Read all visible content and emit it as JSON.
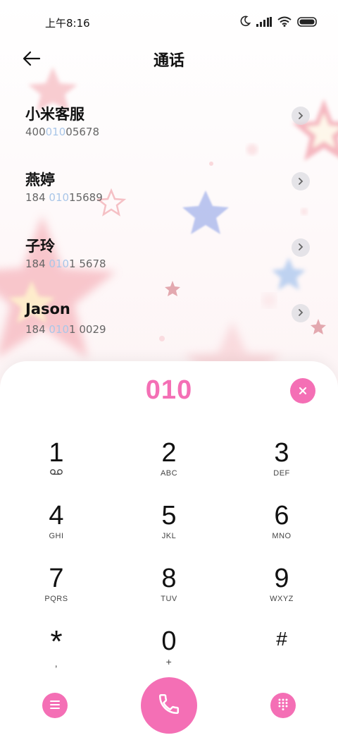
{
  "status_bar": {
    "time": "上午8:16",
    "icons": [
      "moon-icon",
      "signal-icon",
      "wifi-icon",
      "battery-icon"
    ]
  },
  "header": {
    "title": "通话",
    "back_icon": "arrow-left-icon"
  },
  "contacts": [
    {
      "name": "小米客服",
      "number_pre": "400",
      "number_hl": "010",
      "number_post": "05678"
    },
    {
      "name": "燕婷",
      "number_pre": "184 ",
      "number_hl": "010",
      "number_post": "15689"
    },
    {
      "name": "子玲",
      "number_pre": "184 ",
      "number_hl": "010",
      "number_post": "1 5678"
    },
    {
      "name": "Jason",
      "number_pre": "184 ",
      "number_hl": "010",
      "number_post": "1 0029"
    }
  ],
  "dialer": {
    "number": "010",
    "keys": [
      {
        "digit": "1",
        "letters": ""
      },
      {
        "digit": "2",
        "letters": "ABC"
      },
      {
        "digit": "3",
        "letters": "DEF"
      },
      {
        "digit": "4",
        "letters": "GHI"
      },
      {
        "digit": "5",
        "letters": "JKL"
      },
      {
        "digit": "6",
        "letters": "MNO"
      },
      {
        "digit": "7",
        "letters": "PQRS"
      },
      {
        "digit": "8",
        "letters": "TUV"
      },
      {
        "digit": "9",
        "letters": "WXYZ"
      },
      {
        "digit": "*",
        "letters": ","
      },
      {
        "digit": "0",
        "letters": "+"
      },
      {
        "digit": "#",
        "letters": ""
      }
    ]
  },
  "colors": {
    "accent": "#f46fb5",
    "match_highlight": "#a9c6e8"
  }
}
